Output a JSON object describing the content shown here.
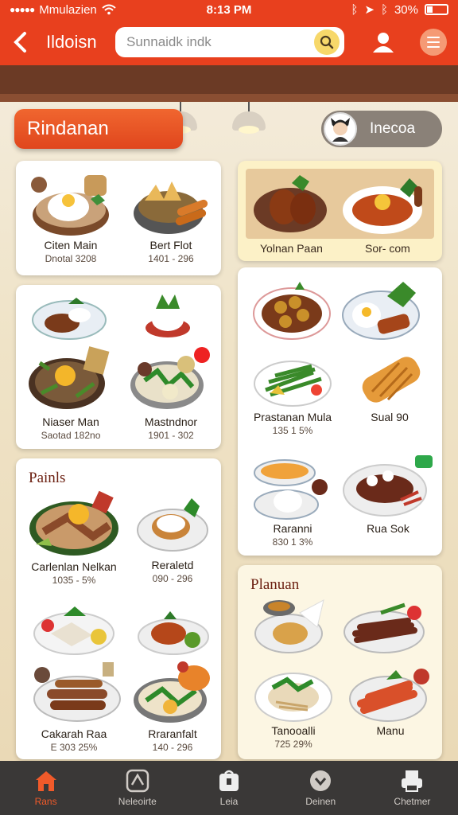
{
  "status_bar": {
    "carrier": "Mmulazien",
    "time": "8:13 PM",
    "battery": "30%",
    "battery_level": 0.3
  },
  "header": {
    "title": "Ildoisn",
    "search_placeholder": "Sunnaidk indk"
  },
  "category": {
    "label": "Rindanan"
  },
  "user": {
    "name": "Inecoa"
  },
  "left_column": {
    "card1": {
      "items": [
        {
          "name": "Citen Main",
          "price": "Dnotal 3208"
        },
        {
          "name": "Bert Flot",
          "price": "1401 - 296"
        }
      ]
    },
    "card2": {
      "items": [
        {
          "name": "Niaser Man",
          "price": "Saotad 182no"
        },
        {
          "name": "Mastndnor",
          "price": "1901 - 302"
        }
      ]
    },
    "card3": {
      "title": "Painls",
      "items": [
        {
          "name": "Carlenlan Nelkan",
          "price": "1035 - 5%"
        },
        {
          "name": "Reraletd",
          "price": "090 - 296"
        },
        {
          "name": "Cakarah Raa",
          "price": "E 303 25%"
        },
        {
          "name": "Rraranfalt",
          "price": "140 - 296"
        }
      ]
    }
  },
  "right_column": {
    "banner": {
      "labels": [
        "Yolnan Paan",
        "Sor- com"
      ]
    },
    "card1": {
      "items": [
        {
          "name": "Prastanan Mula",
          "price": "135 1 5%"
        },
        {
          "name": "Sual 90",
          "price": ""
        },
        {
          "name": "Raranni",
          "price": "830 1 3%"
        },
        {
          "name": "Rua Sok",
          "price": ""
        }
      ]
    },
    "card2": {
      "title": "Planuan",
      "items": [
        {
          "name": "Tanooalli",
          "price": "725 29%"
        },
        {
          "name": "Manu",
          "price": ""
        }
      ]
    }
  },
  "bottom_nav": [
    {
      "label": "Rans",
      "icon": "home-icon",
      "active": true
    },
    {
      "label": "Neleoirte",
      "icon": "compass-icon",
      "active": false
    },
    {
      "label": "Leia",
      "icon": "bag-icon",
      "active": false
    },
    {
      "label": "Deinen",
      "icon": "chevron-circle-icon",
      "active": false
    },
    {
      "label": "Chetmer",
      "icon": "print-icon",
      "active": false
    }
  ],
  "colors": {
    "header": "#e8401e",
    "accent": "#f05a2a",
    "nav_bg": "#3a3837"
  }
}
